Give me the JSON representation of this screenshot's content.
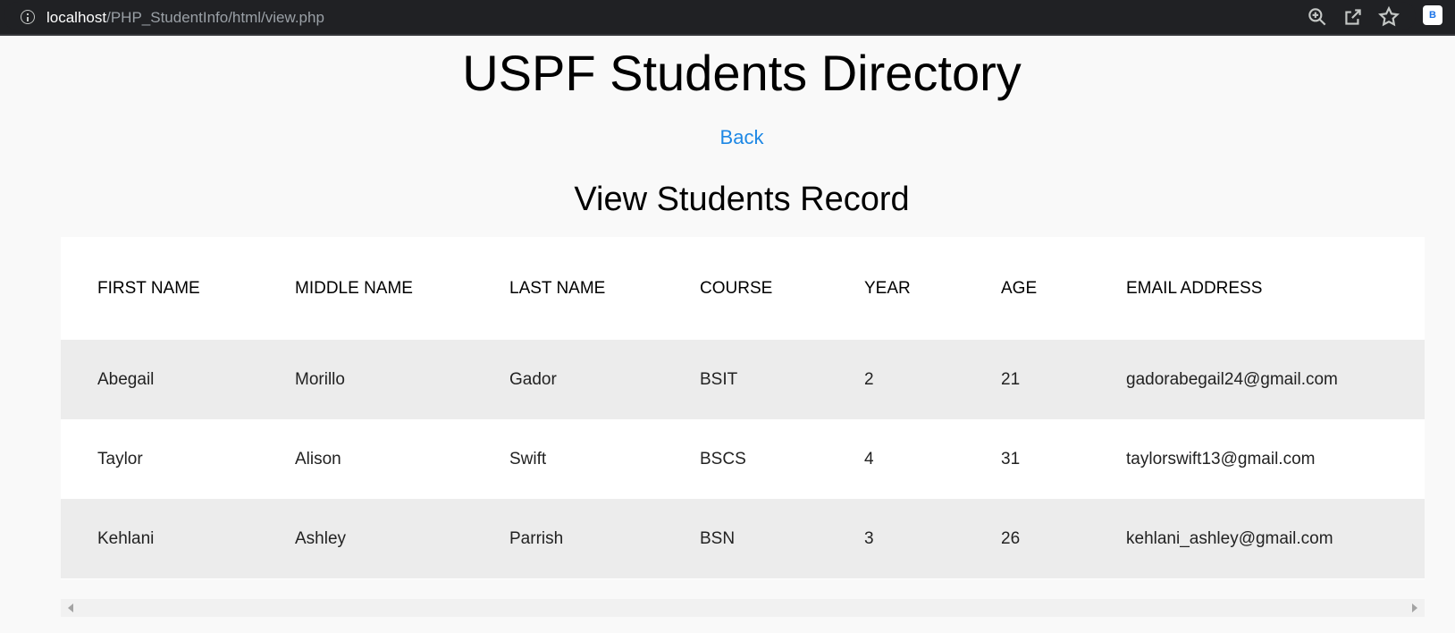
{
  "browser": {
    "url_host": "localhost",
    "url_path": "/PHP_StudentInfo/html/view.php",
    "extension_badge": "B"
  },
  "page": {
    "title": "USPF Students Directory",
    "back_link": "Back",
    "section_title": "View Students Record"
  },
  "table": {
    "headers": [
      "FIRST NAME",
      "MIDDLE NAME",
      "LAST NAME",
      "COURSE",
      "YEAR",
      "AGE",
      "EMAIL ADDRESS"
    ],
    "rows": [
      [
        "Abegail",
        "Morillo",
        "Gador",
        "BSIT",
        "2",
        "21",
        "gadorabegail24@gmail.com"
      ],
      [
        "Taylor",
        "Alison",
        "Swift",
        "BSCS",
        "4",
        "31",
        "taylorswift13@gmail.com"
      ],
      [
        "Kehlani",
        "Ashley",
        "Parrish",
        "BSN",
        "3",
        "26",
        "kehlani_ashley@gmail.com"
      ]
    ]
  },
  "colors": {
    "link": "#1e88e5",
    "browser_bar": "#202124",
    "row_stripe": "#ececec"
  },
  "icons": [
    "info-icon",
    "zoom-icon",
    "share-icon",
    "star-icon"
  ]
}
